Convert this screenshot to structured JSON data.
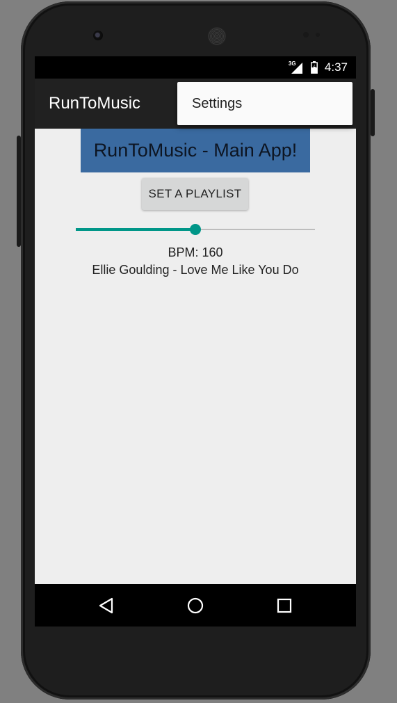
{
  "status_bar": {
    "network": "3G",
    "time": "4:37"
  },
  "app_bar": {
    "title": "RunToMusic"
  },
  "overflow_menu": {
    "items": [
      {
        "label": "Settings"
      }
    ]
  },
  "main": {
    "header": "RunToMusic - Main App!",
    "set_playlist_label": "SET A PLAYLIST",
    "bpm_slider": {
      "value_fraction": 0.5
    },
    "bpm_text": "BPM: 160",
    "now_playing": "Ellie Goulding - Love Me Like You Do"
  },
  "nav_bar": {
    "icons": [
      "back-icon",
      "home-icon",
      "recents-icon"
    ]
  },
  "colors": {
    "accent": "#009688",
    "banner": "#3a6aa0",
    "app_bar": "#212121",
    "background": "#eeeeee"
  }
}
